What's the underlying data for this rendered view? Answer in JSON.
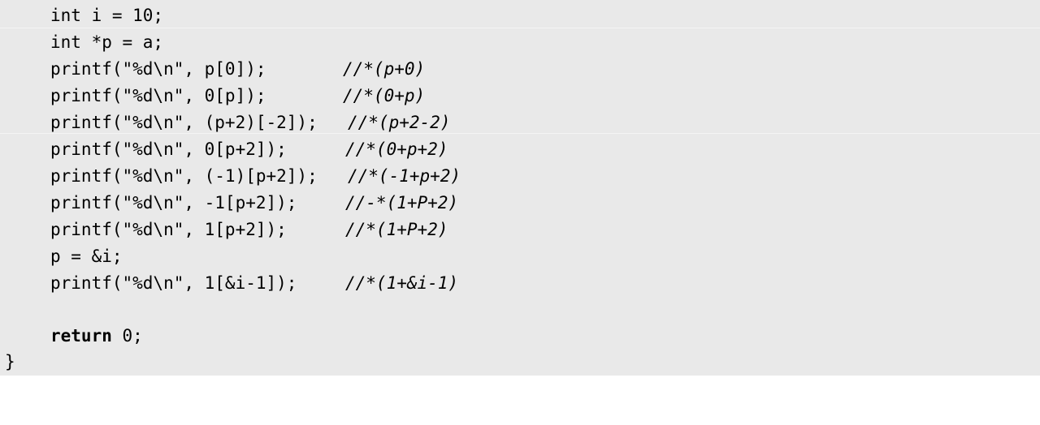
{
  "code": {
    "lines": [
      {
        "text": "int i = 10;",
        "comment": ""
      },
      {
        "text": "int *p = a;",
        "comment": ""
      },
      {
        "text": "printf(\"%d\\n\", p[0]);",
        "comment": "//*(p+0)"
      },
      {
        "text": "printf(\"%d\\n\", 0[p]);",
        "comment": "//*(0+p)"
      },
      {
        "text": "printf(\"%d\\n\", (p+2)[-2]);",
        "comment": "//*(p+2-2)"
      },
      {
        "text": "printf(\"%d\\n\", 0[p+2]);",
        "comment": "//*(0+p+2)"
      },
      {
        "text": "printf(\"%d\\n\", (-1)[p+2]);",
        "comment": "//*(-1+p+2)"
      },
      {
        "text": "printf(\"%d\\n\", -1[p+2]);",
        "comment": "//-*(1+P+2)"
      },
      {
        "text": "printf(\"%d\\n\", 1[p+2]);",
        "comment": "//*(1+P+2)"
      },
      {
        "text": "p = &i;",
        "comment": ""
      },
      {
        "text": "printf(\"%d\\n\", 1[&i-1]);",
        "comment": "//*(1+&i-1)"
      }
    ],
    "return_keyword": "return",
    "return_rest": " 0;",
    "closing_brace": "}"
  }
}
